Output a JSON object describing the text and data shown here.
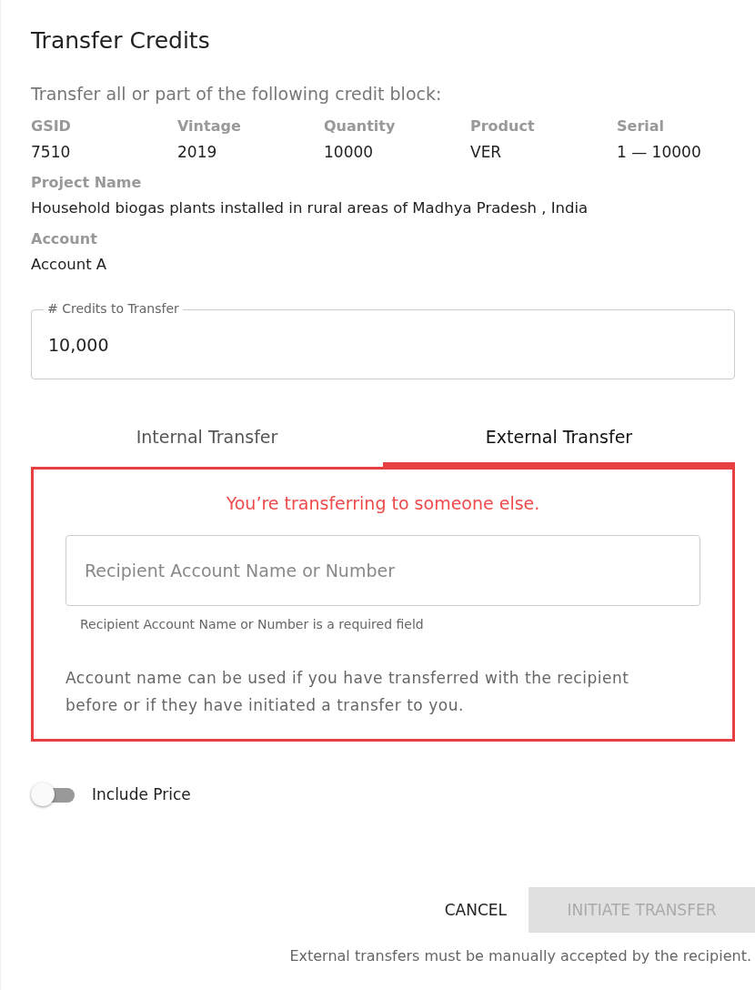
{
  "dialog": {
    "title": "Transfer Credits"
  },
  "intro": "Transfer all or part of the following credit block:",
  "block_fields": [
    {
      "label": "GSID",
      "value": "7510"
    },
    {
      "label": "Vintage",
      "value": "2019"
    },
    {
      "label": "Quantity",
      "value": "10000"
    },
    {
      "label": "Product",
      "value": "VER"
    },
    {
      "label": "Serial",
      "value": "1 — 10000"
    }
  ],
  "details": [
    {
      "label": "Project Name",
      "value": "Household biogas plants installed in rural areas of Madhya Pradesh , India"
    },
    {
      "label": "Account",
      "value": "Account A"
    }
  ],
  "credits_field": {
    "label": "# Credits to Transfer",
    "value": "10,000"
  },
  "tabs": [
    {
      "label": "Internal Transfer",
      "selected": false
    },
    {
      "label": "External Transfer",
      "selected": true
    }
  ],
  "panel": {
    "message": "You’re transferring to someone else.",
    "recipient_field": {
      "placeholder": "Recipient Account Name or Number",
      "error": "Recipient Account Name or Number is a required field"
    },
    "note": "Account name can be used if you have transferred with the recipient before or if they have initiated a transfer to you."
  },
  "include_price": {
    "label": "Include Price",
    "on": false
  },
  "buttons": [
    {
      "label": "CANCEL",
      "kind": "text",
      "disabled": false
    },
    {
      "label": "INITIATE TRANSFER",
      "kind": "filled",
      "disabled": true
    }
  ],
  "footer_note": "External transfers must be manually accepted by the recipient."
}
